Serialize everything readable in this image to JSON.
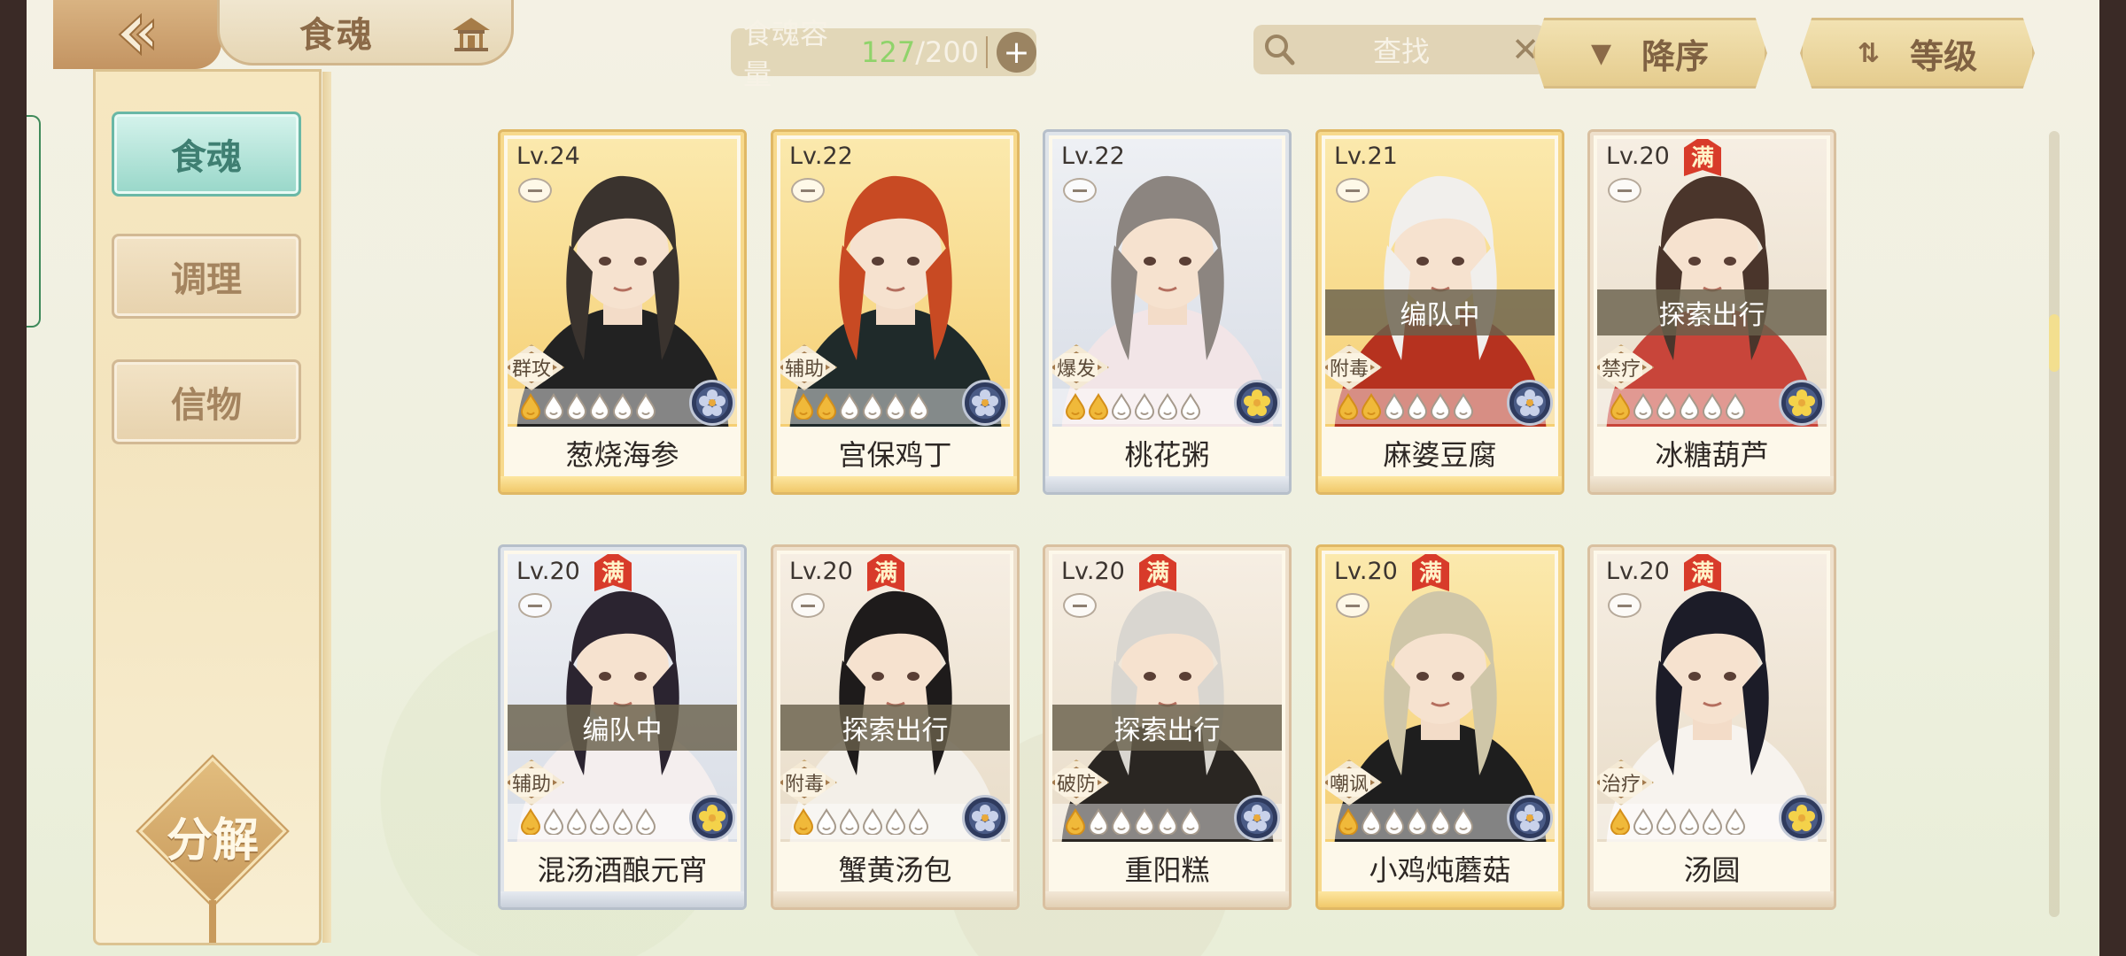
{
  "header": {
    "title": "食魂",
    "capacity_label": "食魂容量",
    "capacity_used": "127",
    "capacity_total": "/200",
    "search_text": "查找",
    "sort_order_label": "降序",
    "sort_key_label": "等级"
  },
  "sidebar": {
    "items": [
      {
        "label": "食魂",
        "active": true
      },
      {
        "label": "调理",
        "active": false
      },
      {
        "label": "信物",
        "active": false
      }
    ],
    "decompose_label": "分解"
  },
  "cards": [
    {
      "level": "Lv.24",
      "name": "葱烧海参",
      "role": "群攻",
      "status": "",
      "full": false,
      "stars": 1,
      "frame": "gold",
      "coin": "blue",
      "hair": "#3a332e",
      "coat": "#222"
    },
    {
      "level": "Lv.22",
      "name": "宫保鸡丁",
      "role": "辅助",
      "status": "",
      "full": false,
      "stars": 2,
      "frame": "gold",
      "coin": "blue",
      "hair": "#c84a23",
      "coat": "#1f2a2a"
    },
    {
      "level": "Lv.22",
      "name": "桃花粥",
      "role": "爆发",
      "status": "",
      "full": false,
      "stars": 2,
      "frame": "silver",
      "coin": "yellow",
      "hair": "#8c8580",
      "coat": "#f2e5e7"
    },
    {
      "level": "Lv.21",
      "name": "麻婆豆腐",
      "role": "附毒",
      "status": "编队中",
      "full": false,
      "stars": 2,
      "frame": "gold",
      "coin": "blue",
      "hair": "#f1efec",
      "coat": "#b6321f"
    },
    {
      "level": "Lv.20",
      "name": "冰糖葫芦",
      "role": "禁疗",
      "status": "探索出行",
      "full": true,
      "stars": 1,
      "frame": "bronze",
      "coin": "yellow",
      "hair": "#4a352b",
      "coat": "#c8453a"
    },
    {
      "level": "Lv.20",
      "name": "混汤酒酿元宵",
      "role": "辅助",
      "status": "编队中",
      "full": true,
      "stars": 1,
      "frame": "silver",
      "coin": "yellow",
      "hair": "#2b2430",
      "coat": "#f4eeee"
    },
    {
      "level": "Lv.20",
      "name": "蟹黄汤包",
      "role": "附毒",
      "status": "探索出行",
      "full": true,
      "stars": 1,
      "frame": "bronze",
      "coin": "blue",
      "hair": "#1e1b1b",
      "coat": "#f3efe8"
    },
    {
      "level": "Lv.20",
      "name": "重阳糕",
      "role": "破防",
      "status": "探索出行",
      "full": true,
      "stars": 1,
      "frame": "bronze",
      "coin": "blue",
      "hair": "#d9d6d0",
      "coat": "#2a2622"
    },
    {
      "level": "Lv.20",
      "name": "小鸡炖蘑菇",
      "role": "嘲讽",
      "status": "",
      "full": true,
      "stars": 1,
      "frame": "gold",
      "coin": "blue",
      "hair": "#cfc6a8",
      "coat": "#1e1e1e"
    },
    {
      "level": "Lv.20",
      "name": "汤圆",
      "role": "治疗",
      "status": "",
      "full": true,
      "stars": 1,
      "frame": "bronze",
      "coin": "yellow",
      "hair": "#1c1c28",
      "coat": "#f7f3ee"
    }
  ],
  "full_badge_label": "满",
  "colors": {
    "accent_teal": "#98d7c9",
    "frame_gold": "#e0b865",
    "badge_red": "#d83b2a"
  }
}
